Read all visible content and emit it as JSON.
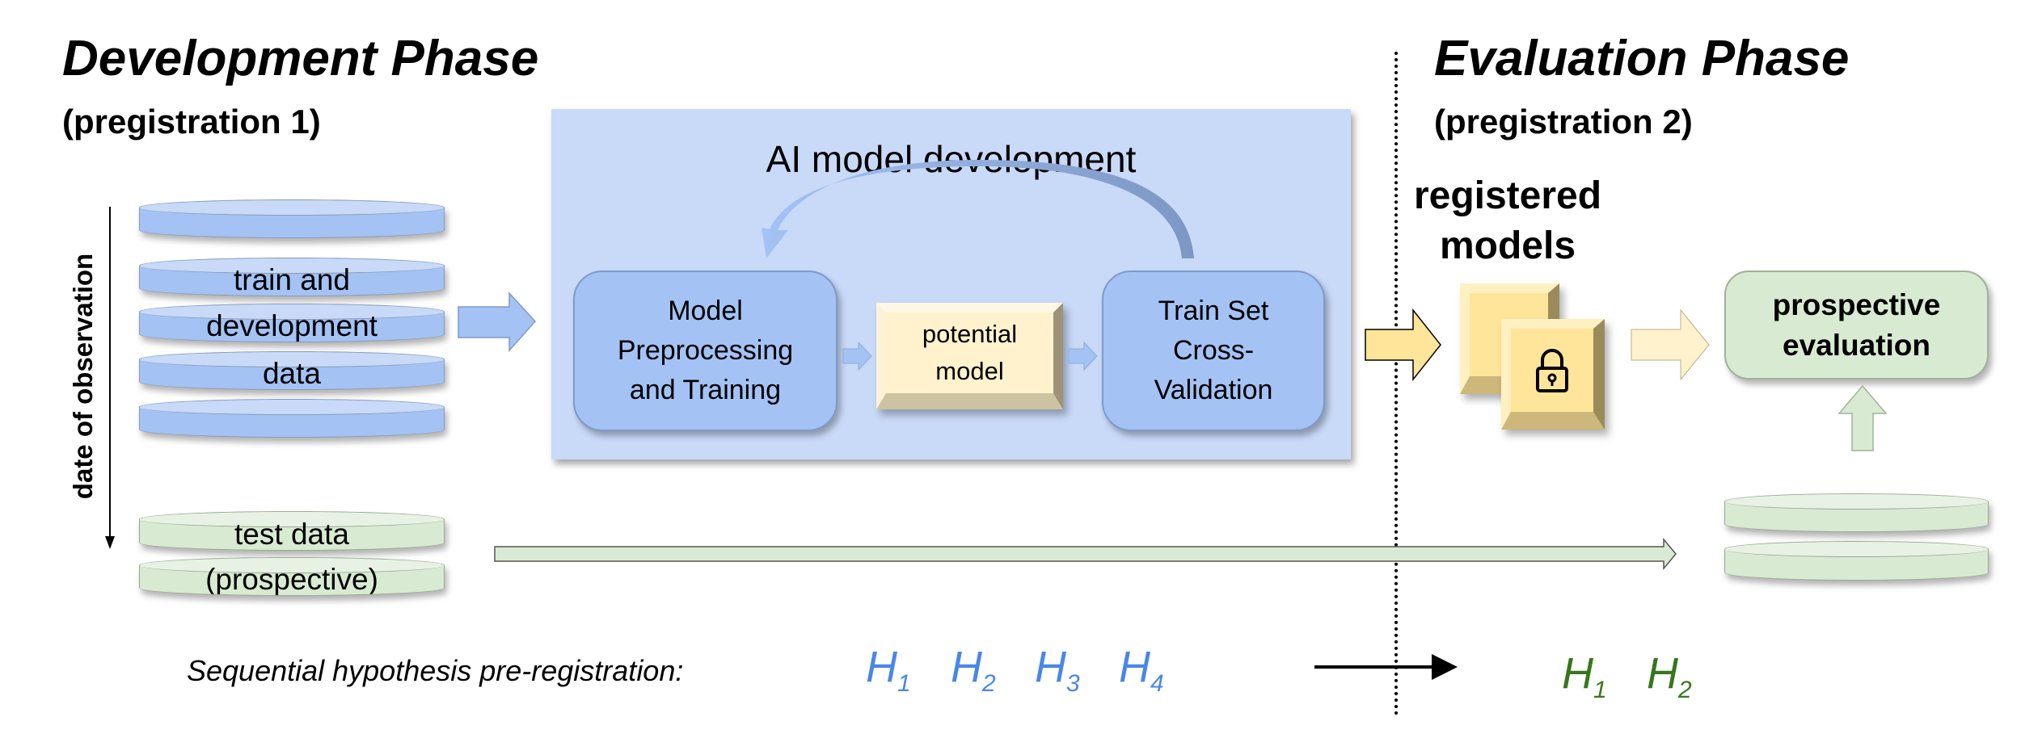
{
  "development": {
    "title": "Development Phase",
    "subtitle": "(pregistration 1)",
    "time_axis_label": "date of observation",
    "train_data_lines": [
      "train and",
      "development",
      "data"
    ],
    "test_data_lines": [
      "test data",
      "(prospective)"
    ],
    "panel": {
      "title": "AI model development",
      "step1": "Model Preprocessing and Training",
      "step2": "potential model",
      "step3": "Train Set Cross-Validation"
    }
  },
  "evaluation": {
    "title": "Evaluation Phase",
    "subtitle": "(pregistration 2)",
    "registered_models": "registered models",
    "prospective_evaluation": "prospective evaluation",
    "lock_icon": "lock-icon"
  },
  "hypotheses": {
    "label": "Sequential hypothesis pre-registration:",
    "development": [
      {
        "letter": "H",
        "sub": "1"
      },
      {
        "letter": "H",
        "sub": "2"
      },
      {
        "letter": "H",
        "sub": "3"
      },
      {
        "letter": "H",
        "sub": "4"
      }
    ],
    "evaluation": [
      {
        "letter": "H",
        "sub": "1"
      },
      {
        "letter": "H",
        "sub": "2"
      }
    ]
  },
  "colors": {
    "blue": "#a4c2f4",
    "blue_light": "#c9daf8",
    "yellow": "#ffe599",
    "yellow_light": "#fff2cc",
    "green": "#d9ead3",
    "hyp_blue": "#4a86e8",
    "hyp_green": "#38761d"
  }
}
